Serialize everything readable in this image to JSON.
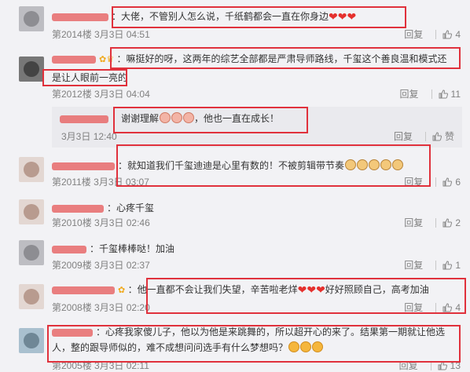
{
  "colors": {
    "accent": "#eb7350",
    "highlight_box": "#e0313c",
    "meta": "#808080"
  },
  "comments": [
    {
      "text": "大佬，不管别人怎么说，千纸鹤都会一直在你身边",
      "floor": "第2014楼",
      "date": "3月3日",
      "time": "04:51",
      "reply": "回复",
      "likes": "4",
      "avatar": "grey"
    },
    {
      "text_line1": "嘛挺好的呀，这两年的综艺全部都是严肃导师路线，千玺这个善良温和模式还",
      "text_line2": "是让人眼前一亮的",
      "floor": "第2012楼",
      "date": "3月3日",
      "time": "04:04",
      "reply": "回复",
      "likes": "11",
      "avatar": "dark"
    },
    {
      "text_pre": "谢谢理解",
      "text_post": "，他也一直在成长！",
      "date": "3月3日",
      "time": "12:40",
      "reply": "回复",
      "likes": "赞"
    },
    {
      "text": "就知道我们千玺迪迪是心里有数的！不被剪辑带节奏",
      "floor": "第2011楼",
      "date": "3月3日",
      "time": "03:07",
      "reply": "回复",
      "likes": "6",
      "avatar": "light"
    },
    {
      "text": "心疼千玺",
      "floor": "第2010楼",
      "date": "3月3日",
      "time": "02:46",
      "reply": "回复",
      "likes": "2",
      "avatar": "light"
    },
    {
      "text": "千玺棒棒哒！加油",
      "floor": "第2009楼",
      "date": "3月3日",
      "time": "02:37",
      "reply": "回复",
      "likes": "1",
      "avatar": "grey"
    },
    {
      "text_pre": "他一直都不会让我们失望，辛苦啦老烊",
      "text_post": "好好照顾自己，高考加油",
      "floor": "第2008楼",
      "date": "3月3日",
      "time": "02:20",
      "reply": "回复",
      "likes": "4",
      "avatar": "light"
    },
    {
      "text_line1": "心疼我家傻儿子，他以为他是来跳舞的，所以超开心的来了。结果第一期就让他选",
      "text_line2": "人，整的跟导师似的，难不成想问问选手有什么梦想吗？",
      "floor": "第2005楼",
      "date": "3月3日",
      "time": "02:11",
      "reply": "回复",
      "likes": "13",
      "avatar": "sky"
    }
  ],
  "icons": {
    "like": "thumbs-up-icon",
    "heart": "heart-emoji",
    "face": "grin-emoji",
    "pig": "pig-emoji",
    "cat": "cat-emoji"
  }
}
